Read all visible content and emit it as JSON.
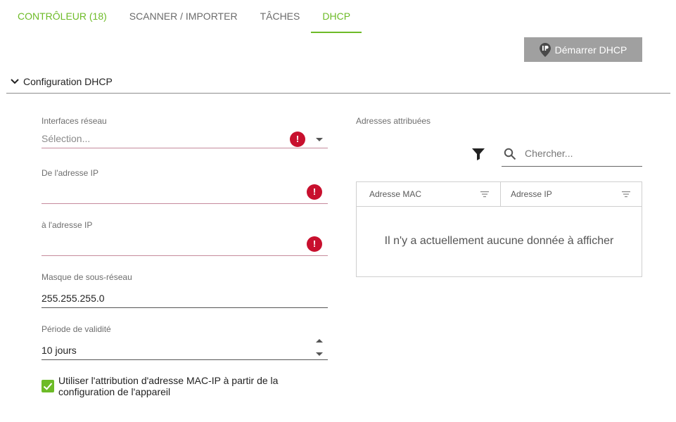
{
  "tabs": [
    {
      "label": "CONTRÔLEUR (18)",
      "state": "green"
    },
    {
      "label": "SCANNER / IMPORTER",
      "state": "normal"
    },
    {
      "label": "TÂCHES",
      "state": "normal"
    },
    {
      "label": "DHCP",
      "state": "active"
    }
  ],
  "start_button": {
    "label": "Démarrer DHCP",
    "icon": "ip-pin-icon"
  },
  "section": {
    "title": "Configuration DHCP",
    "icon": "chevron-down-icon"
  },
  "form": {
    "interfaces": {
      "label": "Interfaces réseau",
      "placeholder": "Sélection...",
      "error_symbol": "!"
    },
    "from_ip": {
      "label": "De l'adresse IP",
      "value": "",
      "error_symbol": "!"
    },
    "to_ip": {
      "label": "à l'adresse IP",
      "value": "",
      "error_symbol": "!"
    },
    "subnet": {
      "label": "Masque de sous-réseau",
      "value": "255.255.255.0"
    },
    "validity": {
      "label": "Période de validité",
      "value": "10 jours"
    },
    "mac_ip_checkbox": {
      "label": "Utiliser l'attribution d'adresse MAC-IP à partir de la configuration de l'appareil",
      "checked": true
    }
  },
  "assigned": {
    "label": "Adresses attribuées",
    "search_placeholder": "Chercher...",
    "columns": [
      "Adresse MAC",
      "Adresse IP"
    ],
    "empty_message": "Il n'y a actuellement aucune donnée à afficher"
  },
  "colors": {
    "accent": "#6dbb27",
    "error": "#c8102e",
    "button_disabled": "#a0a0a0"
  }
}
